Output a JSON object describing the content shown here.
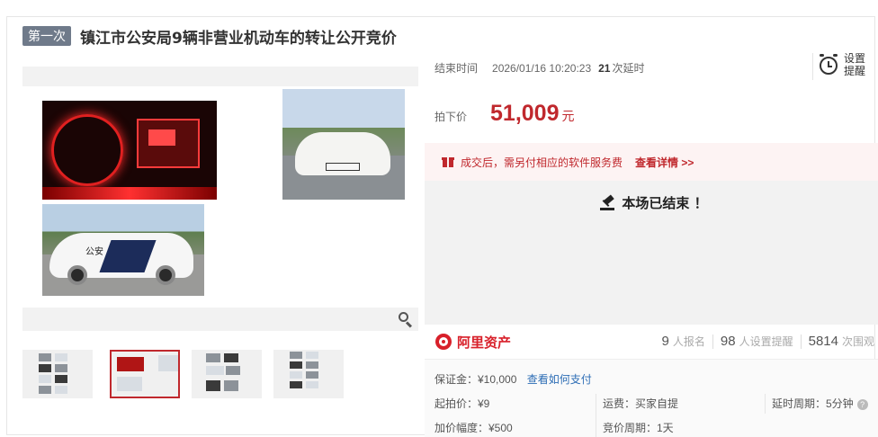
{
  "header": {
    "round_badge": "第一次",
    "title": "镇江市公安局9辆非营业机动车的转让公开竞价"
  },
  "gallery": {
    "thumbnail_count": 4,
    "active_thumbnail": 2,
    "photo_side_text": "公安"
  },
  "auction": {
    "end_time_label": "结束时间",
    "end_time_value": "2026/01/16 10:20:23",
    "delay_count": "21",
    "delay_suffix": "次延时",
    "remind_label": "设置提醒",
    "price_label": "拍下价",
    "price_value": "51,009",
    "price_unit": "元",
    "fee_notice": "成交后，需另付相应的软件服务费",
    "fee_link": "查看详情 >>",
    "ended_message": "本场已结束 ！"
  },
  "platform": {
    "name": "阿里资产",
    "signup_count": "9",
    "signup_label": "人报名",
    "reminder_count": "98",
    "reminder_label": "人设置提醒",
    "view_count": "5814",
    "view_label": "次围观"
  },
  "details": {
    "deposit": "保证金：¥10,000",
    "deposit_link": "查看如何支付",
    "start_price": "起拍价：¥9",
    "shipping": "运费：买家自提",
    "delay_period": "延时周期：5分钟",
    "increment": "加价幅度：¥500",
    "bid_period": "竞价周期：1天"
  },
  "colors": {
    "accent_red": "#c0282d",
    "badge_gray": "#6f7a8a",
    "link_blue": "#2d6db5"
  }
}
